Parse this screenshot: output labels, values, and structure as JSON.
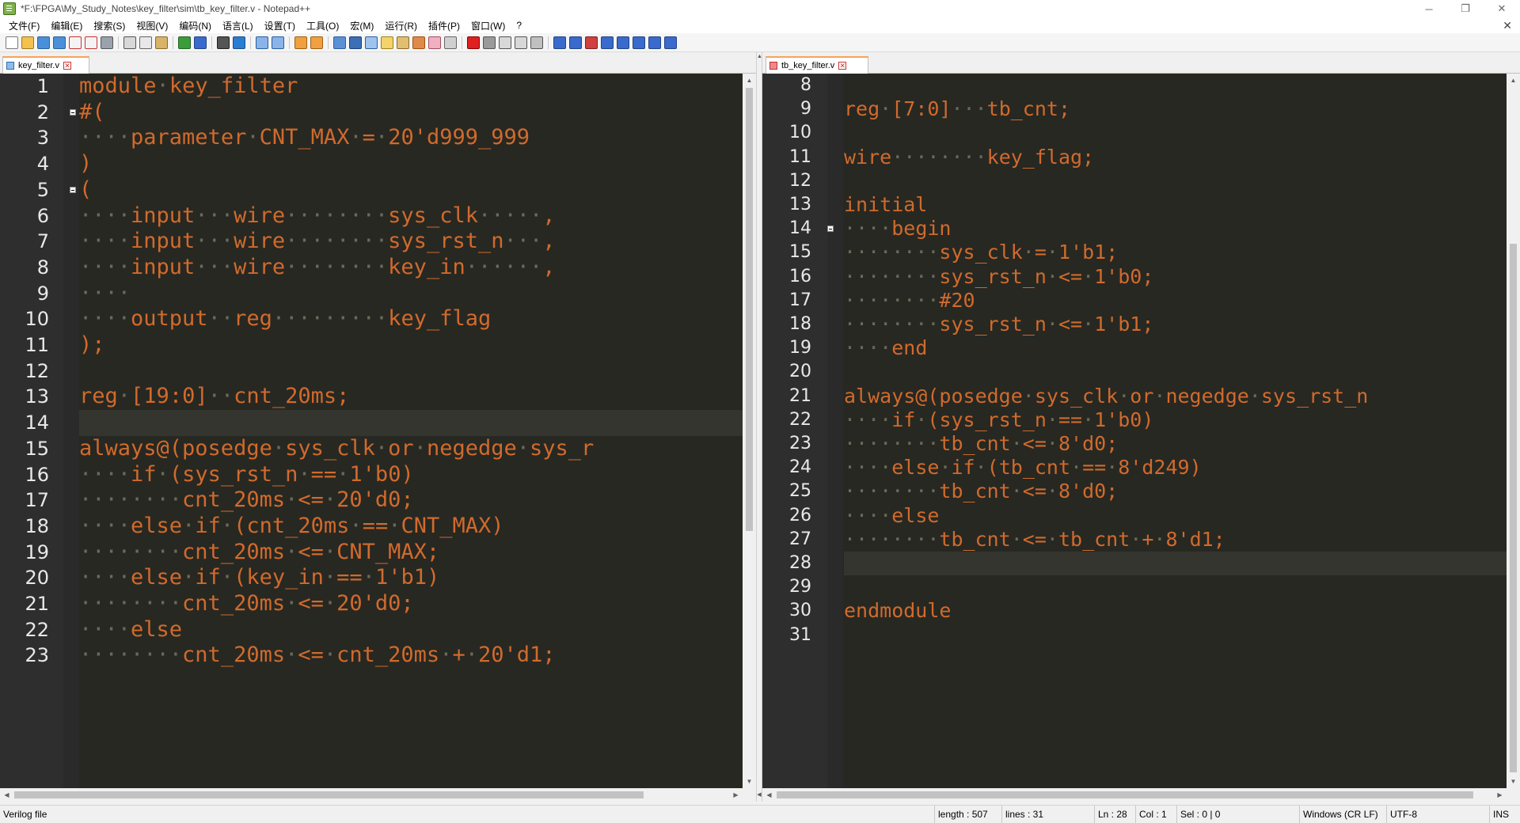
{
  "window": {
    "title": "*F:\\FPGA\\My_Study_Notes\\key_filter\\sim\\tb_key_filter.v - Notepad++",
    "minimize": "─",
    "restore": "❐",
    "close": "✕"
  },
  "menu": {
    "items": [
      "文件(F)",
      "编辑(E)",
      "搜索(S)",
      "视图(V)",
      "编码(N)",
      "语言(L)",
      "设置(T)",
      "工具(O)",
      "宏(M)",
      "运行(R)",
      "插件(P)",
      "窗口(W)",
      "?"
    ],
    "close": "✕"
  },
  "toolbar": {
    "buttons": [
      {
        "icon": "new-file-icon",
        "color": "#ffffff",
        "border": "#7a7a7a"
      },
      {
        "icon": "open-file-icon",
        "color": "#f2c14e",
        "border": "#a07820"
      },
      {
        "icon": "save-icon",
        "color": "#4a90d9",
        "border": "#2a5f9e"
      },
      {
        "icon": "save-all-icon",
        "color": "#4a90d9",
        "border": "#2a5f9e"
      },
      {
        "icon": "close-file-icon",
        "color": "#f3f3f3",
        "border": "#c33"
      },
      {
        "icon": "close-all-icon",
        "color": "#f3f3f3",
        "border": "#c33"
      },
      {
        "icon": "print-icon",
        "color": "#9aa3ad",
        "border": "#555"
      },
      {
        "sep": true
      },
      {
        "icon": "cut-icon",
        "color": "#d8d8d8",
        "border": "#555"
      },
      {
        "icon": "copy-icon",
        "color": "#e8e8e8",
        "border": "#666"
      },
      {
        "icon": "paste-icon",
        "color": "#d9b36a",
        "border": "#8a6a2a"
      },
      {
        "sep": true
      },
      {
        "icon": "undo-icon",
        "color": "#3a9c3a",
        "border": "#226622"
      },
      {
        "icon": "redo-icon",
        "color": "#3a6acc",
        "border": "#224488"
      },
      {
        "sep": true
      },
      {
        "icon": "find-icon",
        "color": "#555555",
        "border": "#222"
      },
      {
        "icon": "replace-icon",
        "color": "#2a7dd1",
        "border": "#1a4f8a"
      },
      {
        "sep": true
      },
      {
        "icon": "zoom-in-icon",
        "color": "#8ab4e8",
        "border": "#2a5f9e"
      },
      {
        "icon": "zoom-out-icon",
        "color": "#8ab4e8",
        "border": "#2a5f9e"
      },
      {
        "sep": true
      },
      {
        "icon": "sync-vertical-icon",
        "color": "#f0a040",
        "border": "#a06010"
      },
      {
        "icon": "sync-horizontal-icon",
        "color": "#f0a040",
        "border": "#a06010"
      },
      {
        "sep": true
      },
      {
        "icon": "word-wrap-icon",
        "color": "#5b8fd6",
        "border": "#2a5f9e"
      },
      {
        "icon": "show-all-chars-icon",
        "color": "#3b6fb6",
        "border": "#1a3f7a"
      },
      {
        "icon": "indent-guide-icon",
        "color": "#9ec3ee",
        "border": "#2a5f9e"
      },
      {
        "icon": "user-lang-icon",
        "color": "#f3d36a",
        "border": "#a08020"
      },
      {
        "icon": "doc-map-icon",
        "color": "#e0c070",
        "border": "#8a6a2a"
      },
      {
        "icon": "function-list-icon",
        "color": "#e08a4a",
        "border": "#a05010"
      },
      {
        "icon": "folder-workspace-icon",
        "color": "#f0b0c0",
        "border": "#a05060"
      },
      {
        "icon": "monitoring-icon",
        "color": "#d0d0d0",
        "border": "#666"
      },
      {
        "sep": true
      },
      {
        "icon": "record-macro-icon",
        "color": "#e02020",
        "border": "#800"
      },
      {
        "icon": "stop-macro-icon",
        "color": "#9a9a9a",
        "border": "#555"
      },
      {
        "icon": "play-macro-icon",
        "color": "#d8d8d8",
        "border": "#555"
      },
      {
        "icon": "run-macro-multiple-icon",
        "color": "#d8d8d8",
        "border": "#555"
      },
      {
        "icon": "save-macro-icon",
        "color": "#c0c0c0",
        "border": "#555"
      },
      {
        "sep": true
      },
      {
        "icon": "compare-icon",
        "color": "#3a6acc",
        "border": "#224488"
      },
      {
        "icon": "compare-panel-icon",
        "color": "#3a6acc",
        "border": "#224488"
      },
      {
        "icon": "compare-clear-icon",
        "color": "#d04040",
        "border": "#802020"
      },
      {
        "icon": "first-diff-icon",
        "color": "#3a6acc",
        "border": "#224488"
      },
      {
        "icon": "prev-diff-icon",
        "color": "#3a6acc",
        "border": "#224488"
      },
      {
        "icon": "next-diff-icon",
        "color": "#3a6acc",
        "border": "#224488"
      },
      {
        "icon": "last-diff-icon",
        "color": "#3a6acc",
        "border": "#224488"
      },
      {
        "icon": "navigation-bar-icon",
        "color": "#3a6acc",
        "border": "#224488"
      }
    ]
  },
  "tabs": {
    "left": {
      "label": "key_filter.v",
      "modified": false,
      "close": "✕"
    },
    "right": {
      "label": "tb_key_filter.v",
      "modified": true,
      "close": "✕"
    }
  },
  "colors": {
    "keyword": "#d16a2c",
    "line_number": "#e8e8e8",
    "whitespace_dot": "#6a6a5a",
    "editor_bg": "#272822",
    "current_line_bg": "#353530"
  },
  "left_editor": {
    "current_line": 14,
    "fold_markers": [
      2,
      5
    ],
    "lines": [
      {
        "n": "1",
        "text": "module·key_filter"
      },
      {
        "n": "2",
        "text": "#("
      },
      {
        "n": "3",
        "text": "····parameter·CNT_MAX·=·20'd999_999"
      },
      {
        "n": "4",
        "text": ")"
      },
      {
        "n": "5",
        "text": "("
      },
      {
        "n": "6",
        "text": "····input···wire········sys_clk·····,"
      },
      {
        "n": "7",
        "text": "····input···wire········sys_rst_n···,"
      },
      {
        "n": "8",
        "text": "····input···wire········key_in······,"
      },
      {
        "n": "9",
        "text": "····"
      },
      {
        "n": "10",
        "text": "····output··reg·········key_flag"
      },
      {
        "n": "11",
        "text": ");"
      },
      {
        "n": "12",
        "text": ""
      },
      {
        "n": "13",
        "text": "reg·[19:0]··cnt_20ms;"
      },
      {
        "n": "14",
        "text": ""
      },
      {
        "n": "15",
        "text": "always@(posedge·sys_clk·or·negedge·sys_r"
      },
      {
        "n": "16",
        "text": "····if·(sys_rst_n·==·1'b0)"
      },
      {
        "n": "17",
        "text": "········cnt_20ms·<=·20'd0;"
      },
      {
        "n": "18",
        "text": "····else·if·(cnt_20ms·==·CNT_MAX)"
      },
      {
        "n": "19",
        "text": "········cnt_20ms·<=·CNT_MAX;"
      },
      {
        "n": "20",
        "text": "····else·if·(key_in·==·1'b1)"
      },
      {
        "n": "21",
        "text": "········cnt_20ms·<=·20'd0;"
      },
      {
        "n": "22",
        "text": "····else"
      },
      {
        "n": "23",
        "text": "········cnt_20ms·<=·cnt_20ms·+·20'd1;"
      }
    ]
  },
  "right_editor": {
    "current_line": 28,
    "fold_markers": [
      14
    ],
    "lines": [
      {
        "n": "8",
        "text": ""
      },
      {
        "n": "9",
        "text": "reg·[7:0]···tb_cnt;"
      },
      {
        "n": "10",
        "text": ""
      },
      {
        "n": "11",
        "text": "wire········key_flag;"
      },
      {
        "n": "12",
        "text": ""
      },
      {
        "n": "13",
        "text": "initial"
      },
      {
        "n": "14",
        "text": "····begin"
      },
      {
        "n": "15",
        "text": "········sys_clk·=·1'b1;"
      },
      {
        "n": "16",
        "text": "········sys_rst_n·<=·1'b0;"
      },
      {
        "n": "17",
        "text": "········#20"
      },
      {
        "n": "18",
        "text": "········sys_rst_n·<=·1'b1;"
      },
      {
        "n": "19",
        "text": "····end"
      },
      {
        "n": "20",
        "text": ""
      },
      {
        "n": "21",
        "text": "always@(posedge·sys_clk·or·negedge·sys_rst_n"
      },
      {
        "n": "22",
        "text": "····if·(sys_rst_n·==·1'b0)"
      },
      {
        "n": "23",
        "text": "········tb_cnt·<=·8'd0;"
      },
      {
        "n": "24",
        "text": "····else·if·(tb_cnt·==·8'd249)"
      },
      {
        "n": "25",
        "text": "········tb_cnt·<=·8'd0;"
      },
      {
        "n": "26",
        "text": "····else"
      },
      {
        "n": "27",
        "text": "········tb_cnt·<=·tb_cnt·+·8'd1;"
      },
      {
        "n": "28",
        "text": ""
      },
      {
        "n": "29",
        "text": ""
      },
      {
        "n": "30",
        "text": "endmodule"
      },
      {
        "n": "31",
        "text": ""
      }
    ]
  },
  "scroll_arrows": {
    "up": "▲",
    "down": "▼",
    "left": "◀",
    "right": "▶"
  },
  "statusbar": {
    "file_type": "Verilog file",
    "length": "length : 507",
    "lines": "lines : 31",
    "ln": "Ln : 28",
    "col": "Col : 1",
    "sel": "Sel : 0 | 0",
    "eol": "Windows (CR LF)",
    "encoding": "UTF-8",
    "mode": "INS"
  }
}
